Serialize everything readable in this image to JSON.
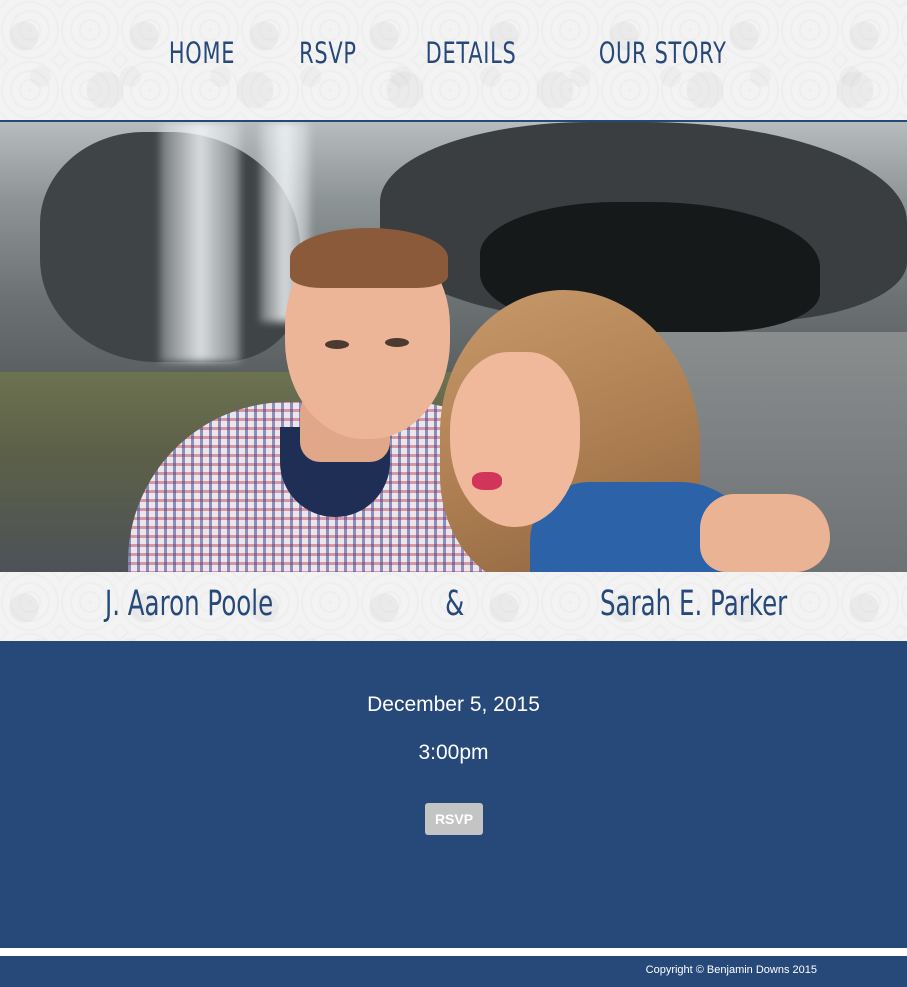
{
  "nav": {
    "items": [
      {
        "label": "HOME"
      },
      {
        "label": "RSVP"
      },
      {
        "label": "DETAILS"
      },
      {
        "label": "OUR STORY"
      }
    ]
  },
  "couple": {
    "groom": "J. Aaron Poole",
    "ampersand": "&",
    "bride": "Sarah E. Parker"
  },
  "event": {
    "date": "December 5, 2015",
    "time": "3:00pm",
    "rsvp_label": "RSVP"
  },
  "footer": {
    "copyright": "Copyright © Benjamin Downs 2015"
  },
  "colors": {
    "brand_navy": "#27497a",
    "button_gray": "#c4c4c4"
  }
}
